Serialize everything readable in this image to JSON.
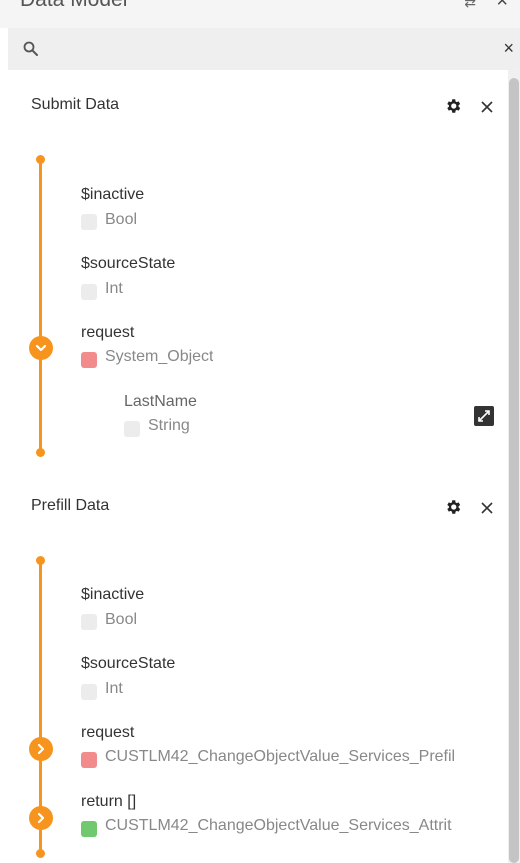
{
  "header": {
    "title": "Data Model",
    "ctrl_a": "⇄",
    "ctrl_b": "×"
  },
  "search": {
    "placeholder": "",
    "value": "",
    "clear": "×"
  },
  "panels": [
    {
      "title": "Submit Data",
      "fields": [
        {
          "name": "$inactive",
          "type": "Bool",
          "color": "#ececec"
        },
        {
          "name": "$sourceState",
          "type": "Int",
          "color": "#ececec"
        },
        {
          "name": "request",
          "type": "System_Object",
          "color": "#f28b8b"
        },
        {
          "name": "LastName",
          "type": "String",
          "color": "#ececec"
        }
      ]
    },
    {
      "title": "Prefill Data",
      "fields": [
        {
          "name": "$inactive",
          "type": "Bool",
          "color": "#ececec"
        },
        {
          "name": "$sourceState",
          "type": "Int",
          "color": "#ececec"
        },
        {
          "name": "request",
          "type": "CUSTLM42_ChangeObjectValue_Services_Prefil",
          "color": "#f28b8b"
        },
        {
          "name": "return []",
          "type": "CUSTLM42_ChangeObjectValue_Services_Attrit",
          "color": "#70c96e"
        }
      ]
    }
  ],
  "icons": {
    "search": "search-icon",
    "gear": "gear-icon",
    "close": "close-icon",
    "expand": "chevron-down-icon",
    "collapsed": "chevron-right-icon",
    "edit": "edit-icon"
  },
  "colors": {
    "accent": "#f7941d"
  }
}
